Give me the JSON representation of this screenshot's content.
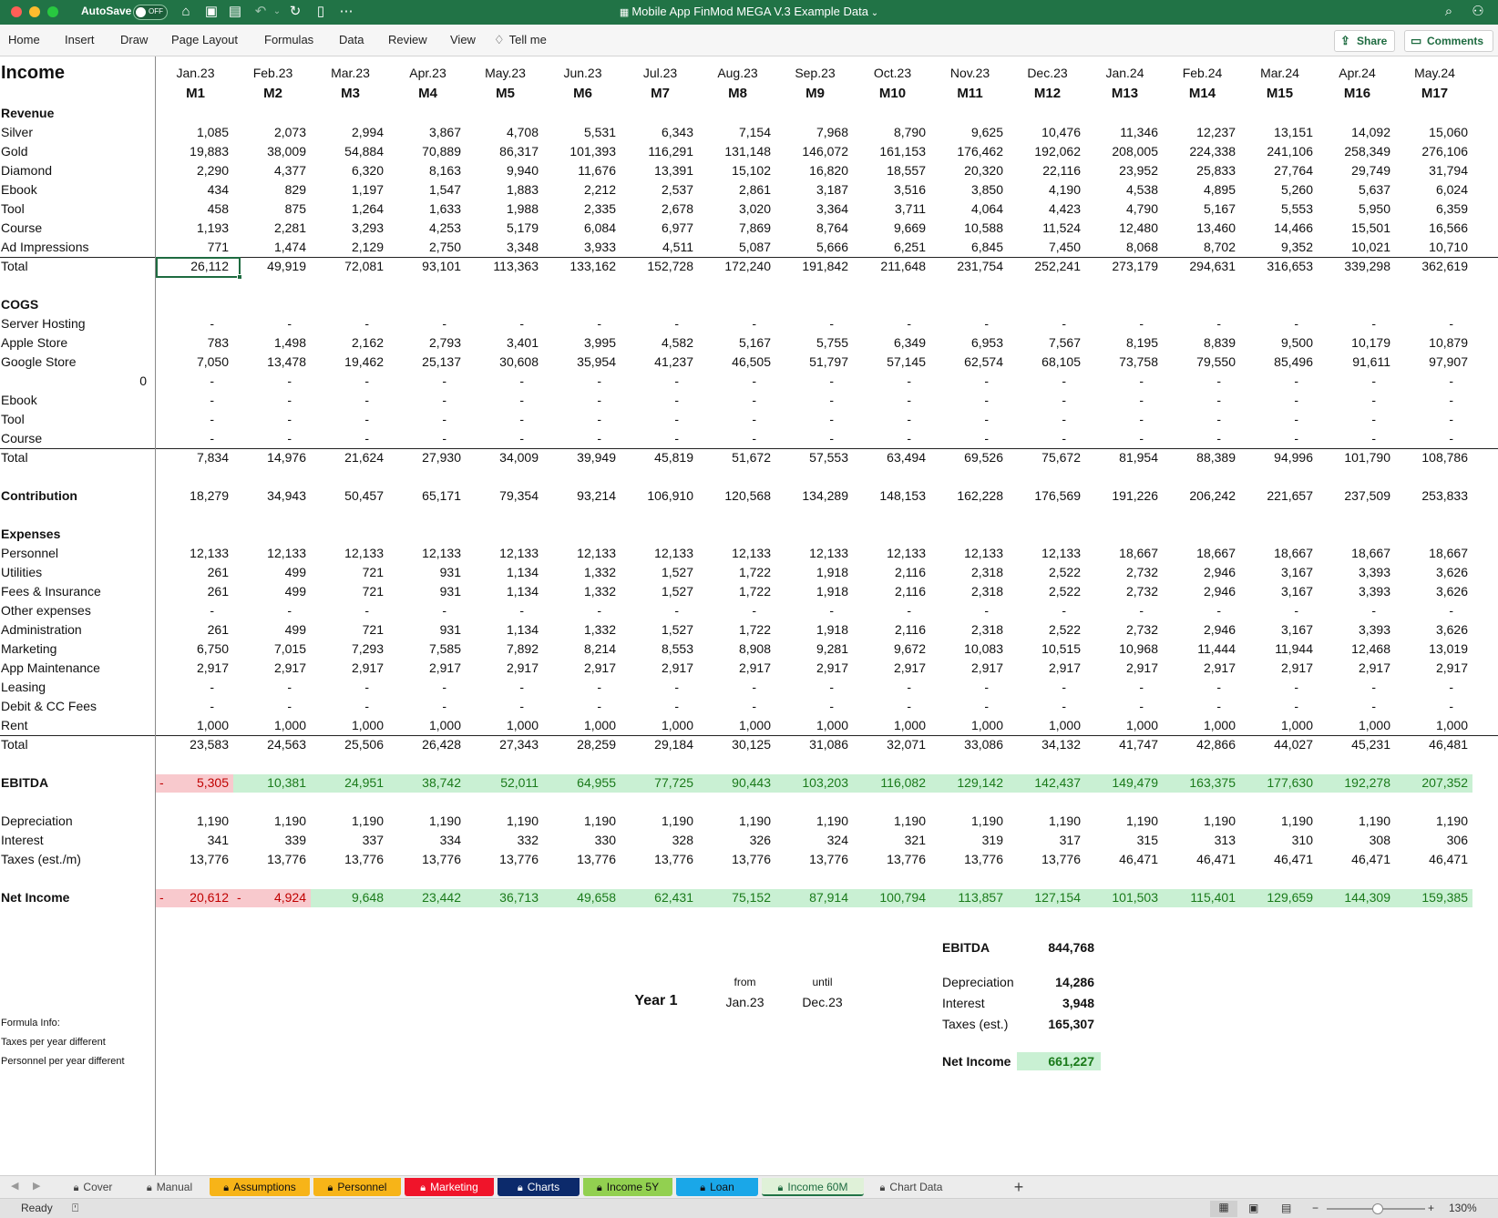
{
  "window": {
    "title": "Mobile App FinMod MEGA V.3 Example Data",
    "autosave_label": "AutoSave",
    "autosave_state": "OFF"
  },
  "ribbon": {
    "tabs": [
      "Home",
      "Insert",
      "Draw",
      "Page Layout",
      "Formulas",
      "Data",
      "Review",
      "View",
      "Tell me"
    ],
    "share_label": "Share",
    "comments_label": "Comments"
  },
  "sheet": {
    "title": "Income",
    "months": [
      "Jan.23",
      "Feb.23",
      "Mar.23",
      "Apr.23",
      "May.23",
      "Jun.23",
      "Jul.23",
      "Aug.23",
      "Sep.23",
      "Oct.23",
      "Nov.23",
      "Dec.23",
      "Jan.24",
      "Feb.24",
      "Mar.24",
      "Apr.24",
      "May.24"
    ],
    "periods": [
      "M1",
      "M2",
      "M3",
      "M4",
      "M5",
      "M6",
      "M7",
      "M8",
      "M9",
      "M10",
      "M11",
      "M12",
      "M13",
      "M14",
      "M15",
      "M16",
      "M17"
    ],
    "rows": [
      {
        "label": "Revenue",
        "bold": true,
        "values": []
      },
      {
        "label": "Silver",
        "values": [
          "1,085",
          "2,073",
          "2,994",
          "3,867",
          "4,708",
          "5,531",
          "6,343",
          "7,154",
          "7,968",
          "8,790",
          "9,625",
          "10,476",
          "11,346",
          "12,237",
          "13,151",
          "14,092",
          "15,060"
        ]
      },
      {
        "label": "Gold",
        "values": [
          "19,883",
          "38,009",
          "54,884",
          "70,889",
          "86,317",
          "101,393",
          "116,291",
          "131,148",
          "146,072",
          "161,153",
          "176,462",
          "192,062",
          "208,005",
          "224,338",
          "241,106",
          "258,349",
          "276,106"
        ]
      },
      {
        "label": "Diamond",
        "values": [
          "2,290",
          "4,377",
          "6,320",
          "8,163",
          "9,940",
          "11,676",
          "13,391",
          "15,102",
          "16,820",
          "18,557",
          "20,320",
          "22,116",
          "23,952",
          "25,833",
          "27,764",
          "29,749",
          "31,794"
        ]
      },
      {
        "label": "Ebook",
        "values": [
          "434",
          "829",
          "1,197",
          "1,547",
          "1,883",
          "2,212",
          "2,537",
          "2,861",
          "3,187",
          "3,516",
          "3,850",
          "4,190",
          "4,538",
          "4,895",
          "5,260",
          "5,637",
          "6,024"
        ]
      },
      {
        "label": "Tool",
        "values": [
          "458",
          "875",
          "1,264",
          "1,633",
          "1,988",
          "2,335",
          "2,678",
          "3,020",
          "3,364",
          "3,711",
          "4,064",
          "4,423",
          "4,790",
          "5,167",
          "5,553",
          "5,950",
          "6,359"
        ]
      },
      {
        "label": "Course",
        "values": [
          "1,193",
          "2,281",
          "3,293",
          "4,253",
          "5,179",
          "6,084",
          "6,977",
          "7,869",
          "8,764",
          "9,669",
          "10,588",
          "11,524",
          "12,480",
          "13,460",
          "14,466",
          "15,501",
          "16,566"
        ]
      },
      {
        "label": "Ad Impressions",
        "values": [
          "771",
          "1,474",
          "2,129",
          "2,750",
          "3,348",
          "3,933",
          "4,511",
          "5,087",
          "5,666",
          "6,251",
          "6,845",
          "7,450",
          "8,068",
          "8,702",
          "9,352",
          "10,021",
          "10,710"
        ]
      },
      {
        "label": "Total",
        "line": true,
        "values": [
          "26,112",
          "49,919",
          "72,081",
          "93,101",
          "113,363",
          "133,162",
          "152,728",
          "172,240",
          "191,842",
          "211,648",
          "231,754",
          "252,241",
          "273,179",
          "294,631",
          "316,653",
          "339,298",
          "362,619"
        ]
      },
      {
        "label": "",
        "values": []
      },
      {
        "label": "COGS",
        "bold": true,
        "values": []
      },
      {
        "label": "Server Hosting",
        "values": [
          "-",
          "-",
          "-",
          "-",
          "-",
          "-",
          "-",
          "-",
          "-",
          "-",
          "-",
          "-",
          "-",
          "-",
          "-",
          "-",
          "-"
        ]
      },
      {
        "label": "Apple Store",
        "values": [
          "783",
          "1,498",
          "2,162",
          "2,793",
          "3,401",
          "3,995",
          "4,582",
          "5,167",
          "5,755",
          "6,349",
          "6,953",
          "7,567",
          "8,195",
          "8,839",
          "9,500",
          "10,179",
          "10,879"
        ]
      },
      {
        "label": "Google Store",
        "values": [
          "7,050",
          "13,478",
          "19,462",
          "25,137",
          "30,608",
          "35,954",
          "41,237",
          "46,505",
          "51,797",
          "57,145",
          "62,574",
          "68,105",
          "73,758",
          "79,550",
          "85,496",
          "91,611",
          "97,907"
        ]
      },
      {
        "label": "0",
        "right": true,
        "values": [
          "-",
          "-",
          "-",
          "-",
          "-",
          "-",
          "-",
          "-",
          "-",
          "-",
          "-",
          "-",
          "-",
          "-",
          "-",
          "-",
          "-"
        ]
      },
      {
        "label": "Ebook",
        "values": [
          "-",
          "-",
          "-",
          "-",
          "-",
          "-",
          "-",
          "-",
          "-",
          "-",
          "-",
          "-",
          "-",
          "-",
          "-",
          "-",
          "-"
        ]
      },
      {
        "label": "Tool",
        "values": [
          "-",
          "-",
          "-",
          "-",
          "-",
          "-",
          "-",
          "-",
          "-",
          "-",
          "-",
          "-",
          "-",
          "-",
          "-",
          "-",
          "-"
        ]
      },
      {
        "label": "Course",
        "values": [
          "-",
          "-",
          "-",
          "-",
          "-",
          "-",
          "-",
          "-",
          "-",
          "-",
          "-",
          "-",
          "-",
          "-",
          "-",
          "-",
          "-"
        ]
      },
      {
        "label": "Total",
        "line": true,
        "values": [
          "7,834",
          "14,976",
          "21,624",
          "27,930",
          "34,009",
          "39,949",
          "45,819",
          "51,672",
          "57,553",
          "63,494",
          "69,526",
          "75,672",
          "81,954",
          "88,389",
          "94,996",
          "101,790",
          "108,786"
        ]
      },
      {
        "label": "",
        "values": []
      },
      {
        "label": "Contribution",
        "bold": true,
        "values": [
          "18,279",
          "34,943",
          "50,457",
          "65,171",
          "79,354",
          "93,214",
          "106,910",
          "120,568",
          "134,289",
          "148,153",
          "162,228",
          "176,569",
          "191,226",
          "206,242",
          "221,657",
          "237,509",
          "253,833"
        ]
      },
      {
        "label": "",
        "values": []
      },
      {
        "label": "Expenses",
        "bold": true,
        "values": []
      },
      {
        "label": "Personnel",
        "values": [
          "12,133",
          "12,133",
          "12,133",
          "12,133",
          "12,133",
          "12,133",
          "12,133",
          "12,133",
          "12,133",
          "12,133",
          "12,133",
          "12,133",
          "18,667",
          "18,667",
          "18,667",
          "18,667",
          "18,667"
        ]
      },
      {
        "label": "Utilities",
        "values": [
          "261",
          "499",
          "721",
          "931",
          "1,134",
          "1,332",
          "1,527",
          "1,722",
          "1,918",
          "2,116",
          "2,318",
          "2,522",
          "2,732",
          "2,946",
          "3,167",
          "3,393",
          "3,626"
        ]
      },
      {
        "label": "Fees & Insurance",
        "values": [
          "261",
          "499",
          "721",
          "931",
          "1,134",
          "1,332",
          "1,527",
          "1,722",
          "1,918",
          "2,116",
          "2,318",
          "2,522",
          "2,732",
          "2,946",
          "3,167",
          "3,393",
          "3,626"
        ]
      },
      {
        "label": "Other expenses",
        "values": [
          "-",
          "-",
          "-",
          "-",
          "-",
          "-",
          "-",
          "-",
          "-",
          "-",
          "-",
          "-",
          "-",
          "-",
          "-",
          "-",
          "-"
        ]
      },
      {
        "label": "Administration",
        "values": [
          "261",
          "499",
          "721",
          "931",
          "1,134",
          "1,332",
          "1,527",
          "1,722",
          "1,918",
          "2,116",
          "2,318",
          "2,522",
          "2,732",
          "2,946",
          "3,167",
          "3,393",
          "3,626"
        ]
      },
      {
        "label": "Marketing",
        "values": [
          "6,750",
          "7,015",
          "7,293",
          "7,585",
          "7,892",
          "8,214",
          "8,553",
          "8,908",
          "9,281",
          "9,672",
          "10,083",
          "10,515",
          "10,968",
          "11,444",
          "11,944",
          "12,468",
          "13,019"
        ]
      },
      {
        "label": "App Maintenance",
        "values": [
          "2,917",
          "2,917",
          "2,917",
          "2,917",
          "2,917",
          "2,917",
          "2,917",
          "2,917",
          "2,917",
          "2,917",
          "2,917",
          "2,917",
          "2,917",
          "2,917",
          "2,917",
          "2,917",
          "2,917"
        ]
      },
      {
        "label": "Leasing",
        "values": [
          "-",
          "-",
          "-",
          "-",
          "-",
          "-",
          "-",
          "-",
          "-",
          "-",
          "-",
          "-",
          "-",
          "-",
          "-",
          "-",
          "-"
        ]
      },
      {
        "label": "Debit & CC Fees",
        "values": [
          "-",
          "-",
          "-",
          "-",
          "-",
          "-",
          "-",
          "-",
          "-",
          "-",
          "-",
          "-",
          "-",
          "-",
          "-",
          "-",
          "-"
        ]
      },
      {
        "label": "Rent",
        "values": [
          "1,000",
          "1,000",
          "1,000",
          "1,000",
          "1,000",
          "1,000",
          "1,000",
          "1,000",
          "1,000",
          "1,000",
          "1,000",
          "1,000",
          "1,000",
          "1,000",
          "1,000",
          "1,000",
          "1,000"
        ]
      },
      {
        "label": "Total",
        "line": true,
        "values": [
          "23,583",
          "24,563",
          "25,506",
          "26,428",
          "27,343",
          "28,259",
          "29,184",
          "30,125",
          "31,086",
          "32,071",
          "33,086",
          "34,132",
          "41,747",
          "42,866",
          "44,027",
          "45,231",
          "46,481"
        ]
      },
      {
        "label": "",
        "values": []
      },
      {
        "label": "EBITDA",
        "bold": true,
        "shade": true,
        "negative": [
          true
        ],
        "values": [
          "5,305",
          "10,381",
          "24,951",
          "38,742",
          "52,011",
          "64,955",
          "77,725",
          "90,443",
          "103,203",
          "116,082",
          "129,142",
          "142,437",
          "149,479",
          "163,375",
          "177,630",
          "192,278",
          "207,352"
        ]
      },
      {
        "label": "",
        "values": []
      },
      {
        "label": "Depreciation",
        "values": [
          "1,190",
          "1,190",
          "1,190",
          "1,190",
          "1,190",
          "1,190",
          "1,190",
          "1,190",
          "1,190",
          "1,190",
          "1,190",
          "1,190",
          "1,190",
          "1,190",
          "1,190",
          "1,190",
          "1,190"
        ]
      },
      {
        "label": "Interest",
        "values": [
          "341",
          "339",
          "337",
          "334",
          "332",
          "330",
          "328",
          "326",
          "324",
          "321",
          "319",
          "317",
          "315",
          "313",
          "310",
          "308",
          "306"
        ]
      },
      {
        "label": "Taxes (est./m)",
        "values": [
          "13,776",
          "13,776",
          "13,776",
          "13,776",
          "13,776",
          "13,776",
          "13,776",
          "13,776",
          "13,776",
          "13,776",
          "13,776",
          "13,776",
          "46,471",
          "46,471",
          "46,471",
          "46,471",
          "46,471"
        ]
      },
      {
        "label": "",
        "values": []
      },
      {
        "label": "Net Income",
        "bold": true,
        "shade": true,
        "negative": [
          true,
          true
        ],
        "values": [
          "20,612",
          "4,924",
          "9,648",
          "23,442",
          "36,713",
          "49,658",
          "62,431",
          "75,152",
          "87,914",
          "100,794",
          "113,857",
          "127,154",
          "101,503",
          "115,401",
          "129,659",
          "144,309",
          "159,385"
        ]
      }
    ],
    "summary": {
      "year_label": "Year 1",
      "from_label": "from",
      "until_label": "until",
      "from_value": "Jan.23",
      "until_value": "Dec.23",
      "ebitda_label": "EBITDA",
      "ebitda_value": "844,768",
      "depreciation_label": "Depreciation",
      "depreciation_value": "14,286",
      "interest_label": "Interest",
      "interest_value": "3,948",
      "taxes_label": "Taxes (est.)",
      "taxes_value": "165,307",
      "net_income_label": "Net Income",
      "net_income_value": "661,227"
    },
    "notes": [
      "Formula Info:",
      "Taxes per year different",
      "Personnel per year different"
    ]
  },
  "sheet_tabs": [
    {
      "label": "Cover",
      "bg": "#ececec",
      "fg": "#444",
      "locked": true
    },
    {
      "label": "Manual",
      "bg": "#ececec",
      "fg": "#444",
      "locked": true
    },
    {
      "label": "Assumptions",
      "bg": "#f7b418",
      "fg": "#111",
      "locked": true
    },
    {
      "label": "Personnel",
      "bg": "#f7b418",
      "fg": "#111",
      "locked": true
    },
    {
      "label": "Marketing",
      "bg": "#f0142a",
      "fg": "#ffffff",
      "locked": true
    },
    {
      "label": "Charts",
      "bg": "#0c2a6b",
      "fg": "#ffffff",
      "locked": true
    },
    {
      "label": "Income 5Y",
      "bg": "#92d050",
      "fg": "#111",
      "locked": true
    },
    {
      "label": "Loan",
      "bg": "#1aa7e8",
      "fg": "#111",
      "locked": true
    },
    {
      "label": "Income 60M",
      "bg": "#dff1d8",
      "fg": "#1e6b40",
      "locked": true,
      "active": true
    },
    {
      "label": "Chart Data",
      "bg": "#ececec",
      "fg": "#444",
      "locked": true
    }
  ],
  "status": {
    "ready": "Ready",
    "zoom": "130%"
  },
  "colors": {
    "accent": "#217346",
    "neg_fill": "#f8c9cd",
    "pos_fill": "#c9f0d3",
    "neg_text": "#c00000",
    "pos_text": "#1a7a1a"
  }
}
